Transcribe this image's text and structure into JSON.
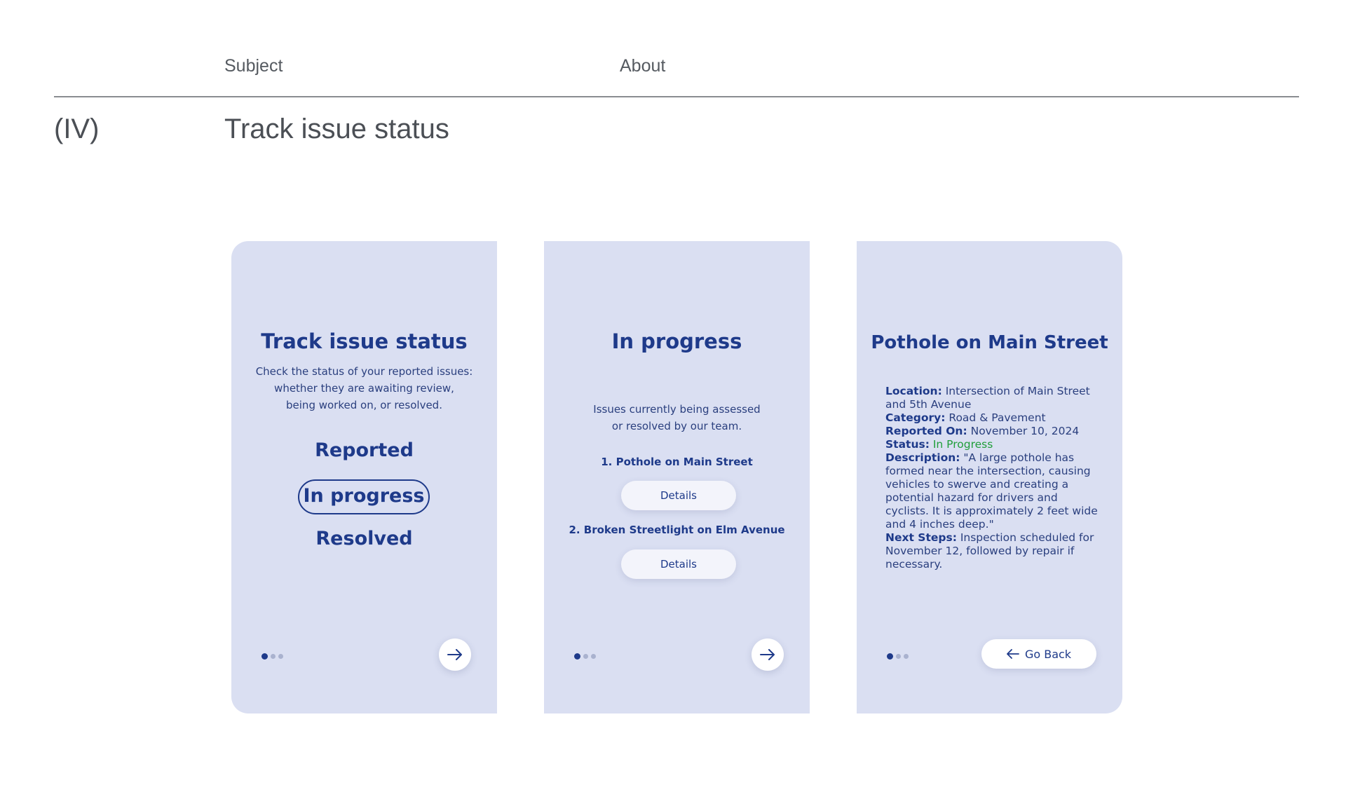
{
  "header": {
    "subject_label": "Subject",
    "about_label": "About",
    "section_number": "(IV)",
    "section_title": "Track issue status"
  },
  "colors": {
    "card_bg": "#dadff2",
    "accent": "#1e3a8a",
    "status_green": "#1f9e3a"
  },
  "screen1": {
    "title": "Track issue status",
    "desc_line1": "Check the status of your reported issues:",
    "desc_line2": "whether they are awaiting review,",
    "desc_line3": "being worked on, or resolved.",
    "status_reported": "Reported",
    "status_in_progress": "In progress",
    "status_resolved": "Resolved",
    "next_icon": "arrow-right-icon"
  },
  "screen2": {
    "title": "In progress",
    "desc_line1": "Issues currently being assessed",
    "desc_line2": "or resolved by our team.",
    "issues": [
      {
        "label": "1.   Pothole on Main Street",
        "button": "Details"
      },
      {
        "label": "2.  Broken Streetlight on Elm Avenue",
        "button": "Details"
      }
    ],
    "next_icon": "arrow-right-icon"
  },
  "screen3": {
    "title": "Pothole on Main Street",
    "location_label": "Location:",
    "location_value": " Intersection of Main Street and 5th Avenue",
    "category_label": "Category:",
    "category_value": " Road & Pavement",
    "reported_label": "Reported On:",
    "reported_value": " November 10, 2024",
    "status_label": "Status:",
    "status_value": " In Progress",
    "description_label": "Description:",
    "description_value": " \"A large pothole has formed near the intersection, causing vehicles to swerve and creating a potential hazard for drivers and cyclists. It is approximately 2 feet wide and 4 inches deep.\"",
    "next_steps_label": "Next Steps:",
    "next_steps_value": " Inspection scheduled for November 12, followed by repair if necessary.",
    "go_back_label": "Go Back",
    "back_icon": "arrow-left-icon"
  }
}
